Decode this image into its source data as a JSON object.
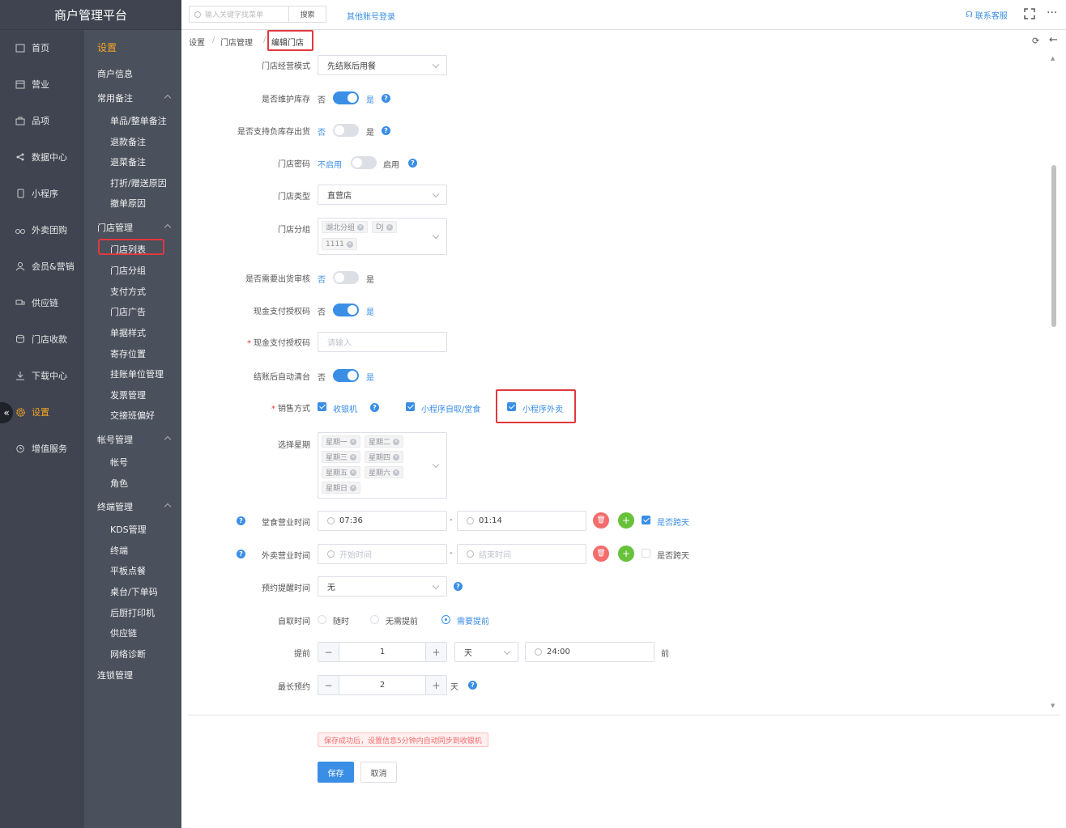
{
  "brand": "商户管理平台",
  "search": {
    "placeholder": "输入关键字找菜单",
    "button": "搜索"
  },
  "topbar": {
    "other_login": "其他账号登录",
    "contact": "联系客服",
    "more": "···"
  },
  "breadcrumb": [
    "设置",
    "门店管理",
    "编辑门店"
  ],
  "nav1": [
    "首页",
    "营业",
    "品项",
    "数据中心",
    "小程序",
    "外卖团购",
    "会员&营销",
    "供应链",
    "门店收款",
    "下载中心",
    "设置",
    "增值服务"
  ],
  "nav2": {
    "title": "设置",
    "merchant_info": "商户信息",
    "common_notes": "常用备注",
    "common_notes_items": [
      "单品/整单备注",
      "退款备注",
      "退菜备注",
      "打折/赠送原因",
      "撤单原因"
    ],
    "store_mgmt": "门店管理",
    "store_mgmt_items": [
      "门店列表",
      "门店分组",
      "支付方式",
      "门店广告",
      "单据样式",
      "寄存位置",
      "挂账单位管理",
      "发票管理",
      "交接班偏好"
    ],
    "account_mgmt": "帐号管理",
    "account_items": [
      "帐号",
      "角色"
    ],
    "terminal_mgmt": "终端管理",
    "terminal_items": [
      "KDS管理",
      "终端",
      "平板点餐",
      "桌台/下单码",
      "后厨打印机",
      "供应链",
      "网络诊断"
    ],
    "chain_mgmt": "连锁管理"
  },
  "form": {
    "mode_label": "门店经营模式",
    "mode_value": "先结账后用餐",
    "stock_label": "是否维护库存",
    "no": "否",
    "yes": "是",
    "neg_stock_label": "是否支持负库存出货",
    "pwd_label": "门店密码",
    "disabled": "不启用",
    "enabled": "启用",
    "type_label": "门店类型",
    "type_value": "直营店",
    "group_label": "门店分组",
    "groups": [
      "湖北分组",
      "DJ",
      "1111"
    ],
    "audit_label": "是否需要出货审核",
    "cash_auth_label": "现金支付授权码",
    "cash_auth_input_label": "现金支付授权码",
    "cash_auth_placeholder": "请输入",
    "auto_clear_label": "结账后自动清台",
    "sale_label": "销售方式",
    "sale_opts": [
      "收银机",
      "小程序自取/堂食",
      "小程序外卖"
    ],
    "week_label": "选择星期",
    "weeks": [
      "星期一",
      "星期二",
      "星期三",
      "星期四",
      "星期五",
      "星期六",
      "星期日"
    ],
    "dine_time_label": "堂食营业时间",
    "dine_start": "07:36",
    "dine_end": "01:14",
    "cross_day": "是否跨天",
    "takeout_time_label": "外卖营业时间",
    "start_ph": "开始时间",
    "end_ph": "结束时间",
    "remind_label": "预约提醒时间",
    "remind_value": "无",
    "pickup_label": "自取时间",
    "pickup_opts": [
      "随时",
      "无需提前",
      "需要提前"
    ],
    "advance_label": "提前",
    "advance_num": "1",
    "advance_unit": "天",
    "advance_time": "24:00",
    "before": "前",
    "max_label": "最长预约",
    "max_num": "2",
    "max_unit": "天",
    "dash": "-"
  },
  "notice": "保存成功后，设置信息5分钟内自动同步到收银机",
  "buttons": {
    "save": "保存",
    "cancel": "取消"
  },
  "colors": {
    "primary": "#3a8ee6",
    "highlight": "#e0393e",
    "active_nav": "#f5a623"
  }
}
